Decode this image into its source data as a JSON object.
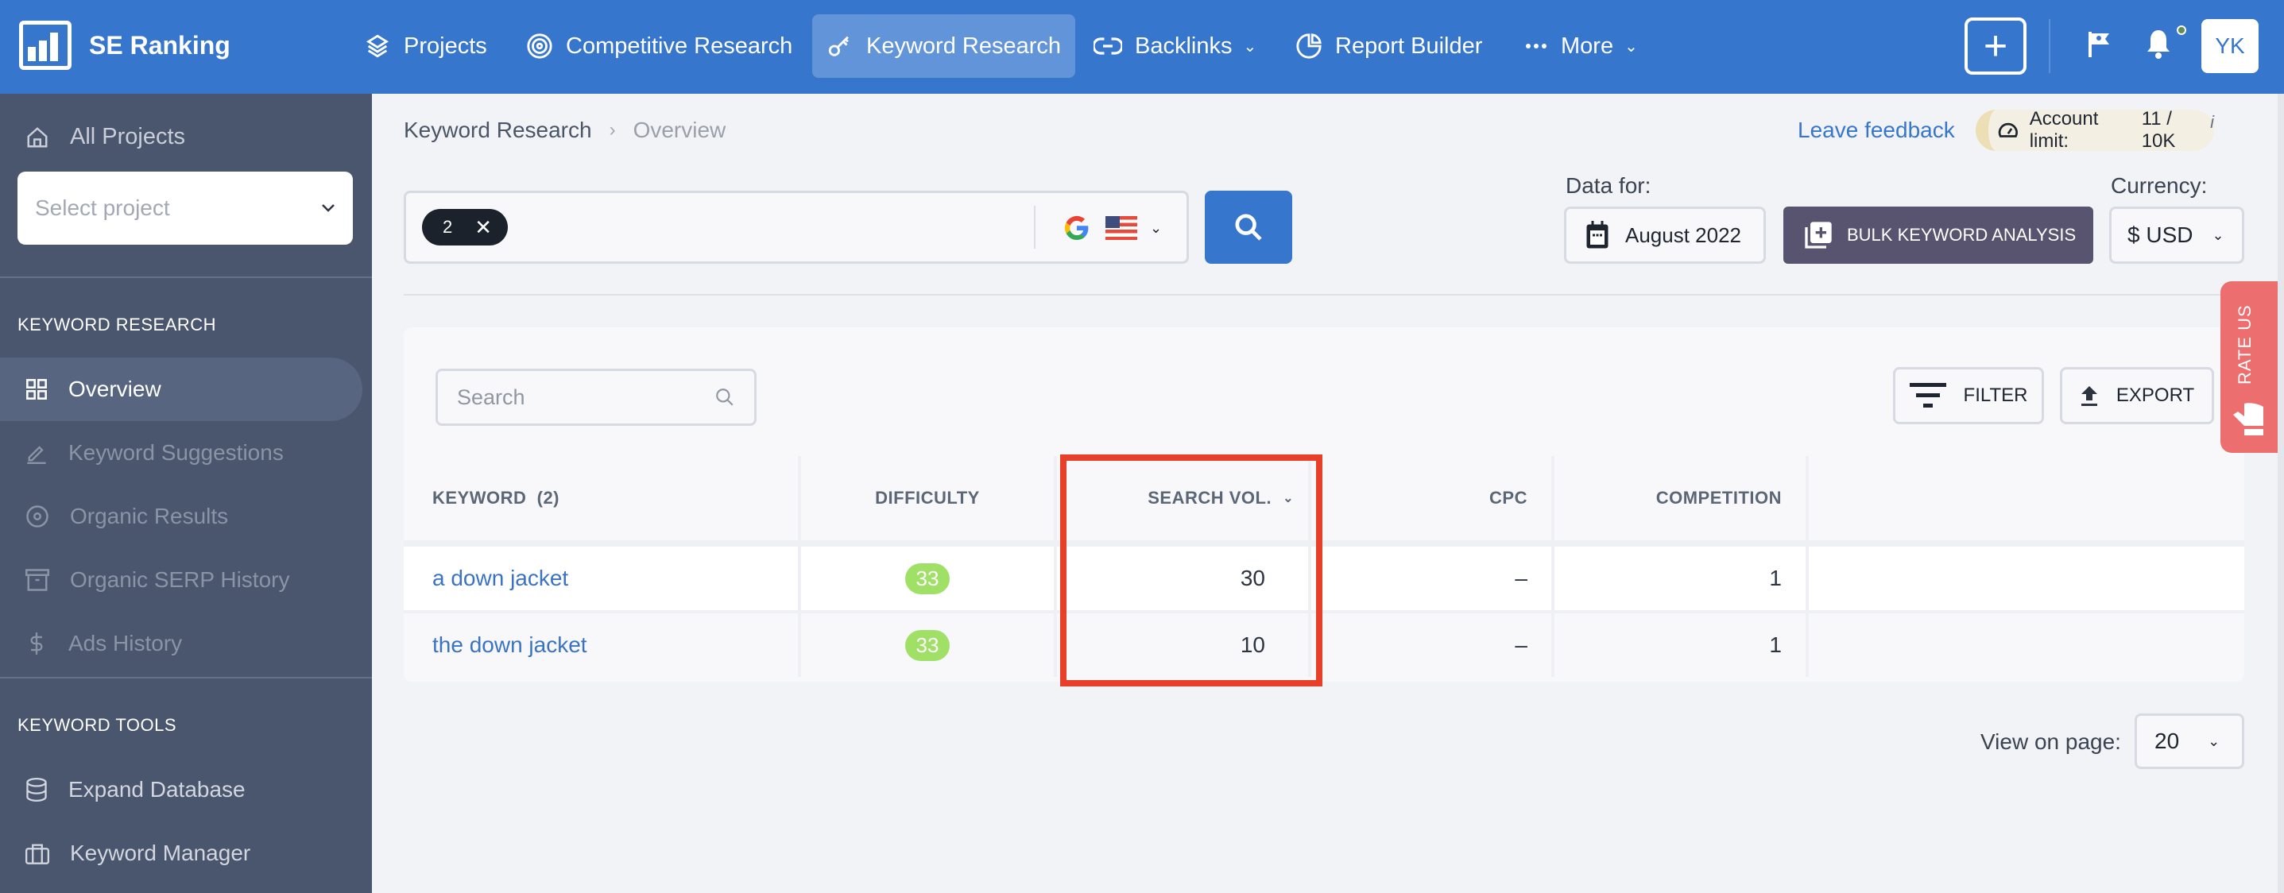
{
  "app": {
    "name": "SE Ranking"
  },
  "nav": {
    "items": [
      {
        "label": "Projects",
        "icon": "layers-icon"
      },
      {
        "label": "Competitive Research",
        "icon": "target-icon"
      },
      {
        "label": "Keyword Research",
        "icon": "key-icon",
        "active": true
      },
      {
        "label": "Backlinks",
        "icon": "link-icon",
        "dropdown": true
      },
      {
        "label": "Report Builder",
        "icon": "pie-chart-icon"
      },
      {
        "label": "More",
        "icon": "dots-icon",
        "dropdown": true
      }
    ],
    "add_label": "+",
    "avatar_initials": "YK"
  },
  "sidebar": {
    "all_projects": "All Projects",
    "select_project_placeholder": "Select project",
    "sections": [
      {
        "title": "KEYWORD RESEARCH",
        "items": [
          {
            "label": "Overview",
            "icon": "grid-icon",
            "active": true
          },
          {
            "label": "Keyword Suggestions",
            "icon": "pencil-icon"
          },
          {
            "label": "Organic Results",
            "icon": "target-icon"
          },
          {
            "label": "Organic SERP History",
            "icon": "archive-icon"
          },
          {
            "label": "Ads History",
            "icon": "dollar-icon"
          }
        ]
      },
      {
        "title": "KEYWORD TOOLS",
        "items": [
          {
            "label": "Expand Database",
            "icon": "database-icon"
          },
          {
            "label": "Keyword Manager",
            "icon": "briefcase-icon"
          }
        ]
      }
    ]
  },
  "breadcrumb": {
    "parent": "Keyword Research",
    "separator": "›",
    "current": "Overview"
  },
  "header": {
    "feedback_link": "Leave feedback",
    "account_limit_label": "Account limit:",
    "account_limit_value": "11 / 10K",
    "account_limit_info": "i"
  },
  "search": {
    "chip_count": "2",
    "chip_remove": "✕",
    "engine": "G",
    "country": "US"
  },
  "data_for": {
    "label": "Data for:",
    "value": "August 2022"
  },
  "bulk_button": "BULK KEYWORD ANALYSIS",
  "currency": {
    "label": "Currency:",
    "value": "$ USD"
  },
  "table_toolbar": {
    "search_placeholder": "Search",
    "filter_label": "FILTER",
    "export_label": "EXPORT"
  },
  "table": {
    "columns": [
      "KEYWORD  (2)",
      "DIFFICULTY",
      "SEARCH VOL.",
      "CPC",
      "COMPETITION"
    ],
    "sorted_column": "SEARCH VOL.",
    "rows": [
      {
        "keyword": "a down jacket",
        "difficulty": "33",
        "search_vol": "30",
        "cpc": "–",
        "competition": "1"
      },
      {
        "keyword": "the down jacket",
        "difficulty": "33",
        "search_vol": "10",
        "cpc": "–",
        "competition": "1"
      }
    ]
  },
  "pagination": {
    "label": "View on page:",
    "value": "20"
  },
  "rate_us": "RATE US",
  "colors": {
    "brand_blue": "#3676cc",
    "sidebar": "#4a566e",
    "difficulty_green": "#a1e067",
    "highlight_red": "#e84028",
    "rate_us": "#ed6e6e",
    "bulk_button": "#58536f"
  }
}
